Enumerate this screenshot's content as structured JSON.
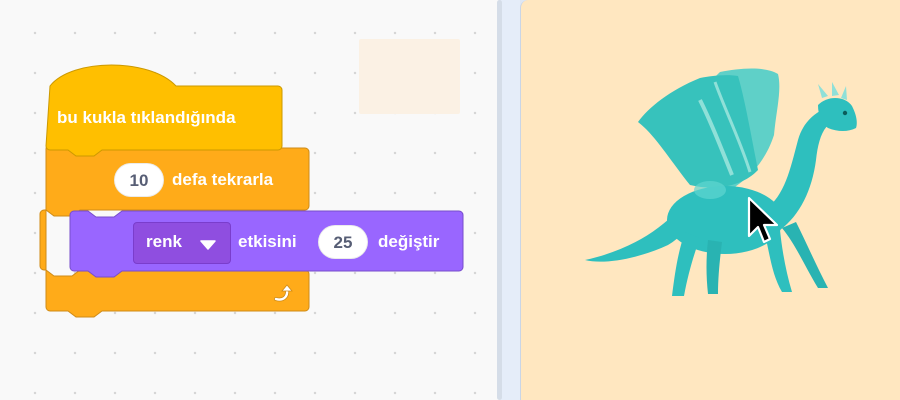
{
  "code_area": {
    "hat_block": {
      "label": "bu kukla tıklandığında"
    },
    "repeat_block": {
      "count": "10",
      "label": "defa tekrarla"
    },
    "effect_block": {
      "effect_selected": "renk",
      "label_mid": "etkisini",
      "amount": "25",
      "label_end": "değiştir"
    }
  },
  "stage": {
    "sprite": "dragon-sprite",
    "cursor": "mouse-pointer-icon"
  },
  "colors": {
    "events": "#ffbf00",
    "control": "#ffab19",
    "looks": "#9966ff",
    "stage_bg": "#ffe7c0",
    "dragon": "#2ebfbe"
  }
}
